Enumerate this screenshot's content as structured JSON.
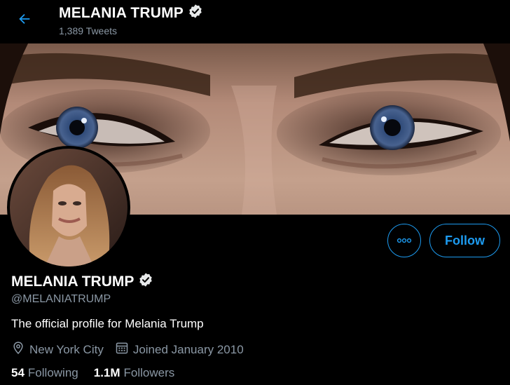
{
  "header": {
    "name": "MELANIA TRUMP",
    "tweet_count": "1,389 Tweets"
  },
  "profile": {
    "name": "MELANIA TRUMP",
    "handle": "@MELANIATRUMP",
    "bio": "The official profile for Melania Trump",
    "location": "New York City",
    "joined": "Joined January 2010",
    "following_count": "54",
    "following_label": "Following",
    "followers_count": "1.1M",
    "followers_label": "Followers"
  },
  "actions": {
    "follow_label": "Follow"
  },
  "icons": {
    "back": "arrow-left-icon",
    "verified": "verified-badge-icon",
    "more": "more-options-icon",
    "location": "location-pin-icon",
    "calendar": "calendar-icon"
  },
  "colors": {
    "accent": "#1d9bf0",
    "secondary_text": "#8b98a5",
    "background": "#000000"
  }
}
